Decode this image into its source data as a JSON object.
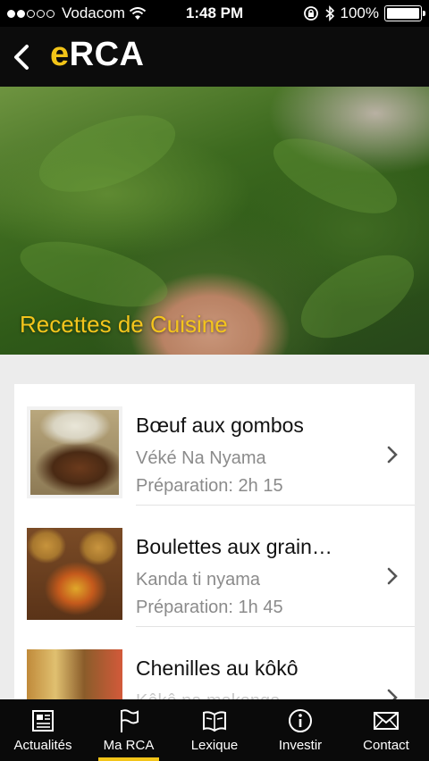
{
  "status": {
    "carrier": "Vodacom",
    "time": "1:48 PM",
    "battery": "100%",
    "battery_level": 1.0
  },
  "nav": {
    "title_prefix": "e",
    "title_rest": "RCA",
    "back_icon": "chevron-left-icon"
  },
  "hero": {
    "caption": "Recettes de Cuisine"
  },
  "recipes": [
    {
      "title": "Bœuf aux gombos",
      "subtitle": "Véké Na Nyama",
      "prep": "Préparation: 2h 15"
    },
    {
      "title": "Boulettes aux grain…",
      "subtitle": "Kanda ti nyama",
      "prep": "Préparation: 1h 45"
    },
    {
      "title": "Chenilles au kôkô",
      "subtitle": "Kôkô na makongo",
      "prep": ""
    }
  ],
  "tabs": [
    {
      "label": "Actualités",
      "icon": "newspaper-icon"
    },
    {
      "label": "Ma RCA",
      "icon": "flag-icon",
      "active": true
    },
    {
      "label": "Lexique",
      "icon": "book-icon"
    },
    {
      "label": "Investir",
      "icon": "info-icon"
    },
    {
      "label": "Contact",
      "icon": "envelope-icon"
    }
  ],
  "colors": {
    "accent": "#f2c418",
    "bar_background": "#0a0a0a",
    "list_background": "#ececec",
    "secondary_text": "#8b8b8b"
  }
}
